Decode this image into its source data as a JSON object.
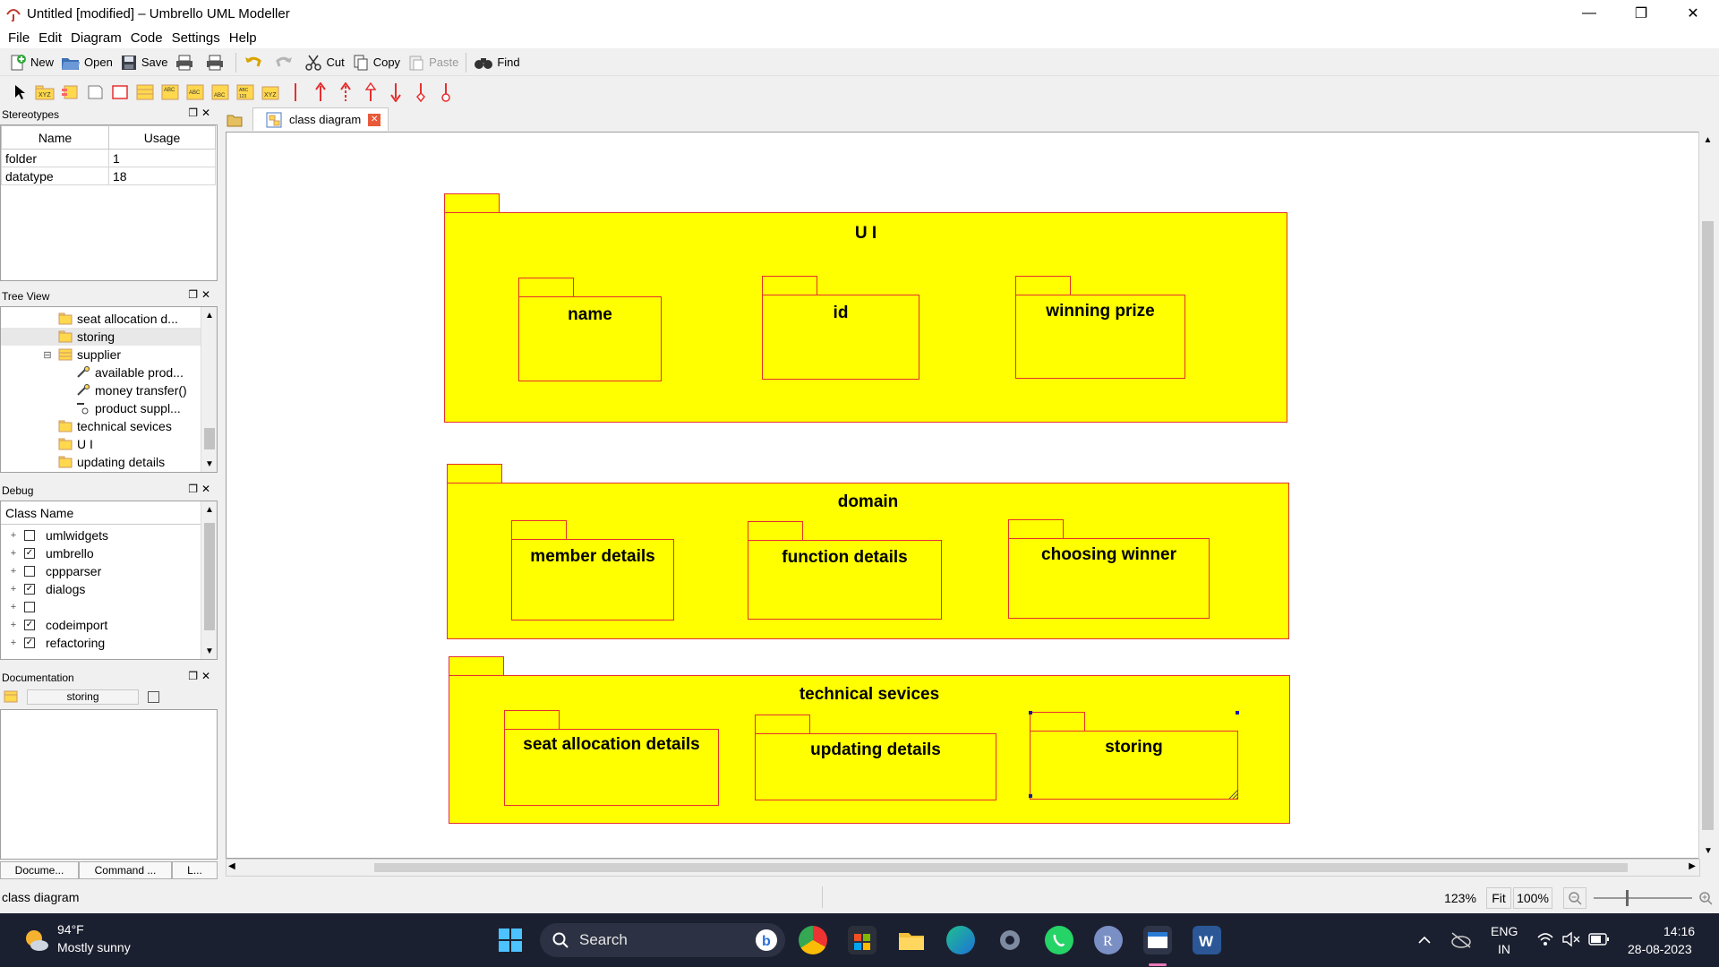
{
  "window": {
    "title": "Untitled [modified] – Umbrello UML Modeller",
    "controls": {
      "minimize": "—",
      "maximize": "❐",
      "close": "✕"
    }
  },
  "menu": [
    "File",
    "Edit",
    "Diagram",
    "Code",
    "Settings",
    "Help"
  ],
  "toolbar": {
    "new": "New",
    "open": "Open",
    "save": "Save",
    "cut": "Cut",
    "copy": "Copy",
    "paste": "Paste",
    "find": "Find"
  },
  "stereotypes": {
    "title": "Stereotypes",
    "columns": [
      "Name",
      "Usage"
    ],
    "rows": [
      {
        "name": "folder",
        "usage": "1"
      },
      {
        "name": "datatype",
        "usage": "18"
      }
    ]
  },
  "tree_view": {
    "title": "Tree View",
    "items": [
      {
        "label": "seat allocation d...",
        "icon": "package-icon"
      },
      {
        "label": "storing",
        "icon": "package-icon"
      },
      {
        "label": "supplier",
        "icon": "class-icon"
      },
      {
        "label": "available prod...",
        "icon": "operation-icon"
      },
      {
        "label": "money transfer()",
        "icon": "operation-icon"
      },
      {
        "label": "product suppl...",
        "icon": "attribute-icon"
      },
      {
        "label": "technical sevices",
        "icon": "package-icon"
      },
      {
        "label": "U I",
        "icon": "package-icon"
      },
      {
        "label": "updating details",
        "icon": "package-icon"
      }
    ]
  },
  "debug": {
    "title": "Debug",
    "column": "Class Name",
    "rows": [
      {
        "label": "umlwidgets",
        "checked": false
      },
      {
        "label": "umbrello",
        "checked": true
      },
      {
        "label": "cppparser",
        "checked": false
      },
      {
        "label": "dialogs",
        "checked": true
      },
      {
        "label": "",
        "checked": false
      },
      {
        "label": "codeimport",
        "checked": true
      },
      {
        "label": "refactoring",
        "checked": true
      }
    ]
  },
  "documentation": {
    "title": "Documentation",
    "name": "storing"
  },
  "bottom_tabs": [
    "Docume...",
    "Command ...",
    "L..."
  ],
  "diagram_tab": "class diagram",
  "packages": {
    "ui": {
      "label": "U I",
      "children": [
        "name",
        "id",
        "winning prize"
      ]
    },
    "domain": {
      "label": "domain",
      "children": [
        "member details",
        "function details",
        "choosing winner"
      ]
    },
    "technical": {
      "label": "technical sevices",
      "children": [
        "seat allocation details",
        "updating details",
        "storing"
      ]
    }
  },
  "status": {
    "text": "class diagram",
    "zoom": "123%",
    "fit": "Fit",
    "full": "100%"
  },
  "taskbar": {
    "weather_temp": "94°F",
    "weather_desc": "Mostly sunny",
    "search": "Search",
    "lang": "ENG",
    "region": "IN",
    "time": "14:16",
    "date": "28-08-2023"
  },
  "colors": {
    "package_fill": "#ffff00",
    "package_border": "#e53030",
    "taskbar": "#1b2030"
  }
}
